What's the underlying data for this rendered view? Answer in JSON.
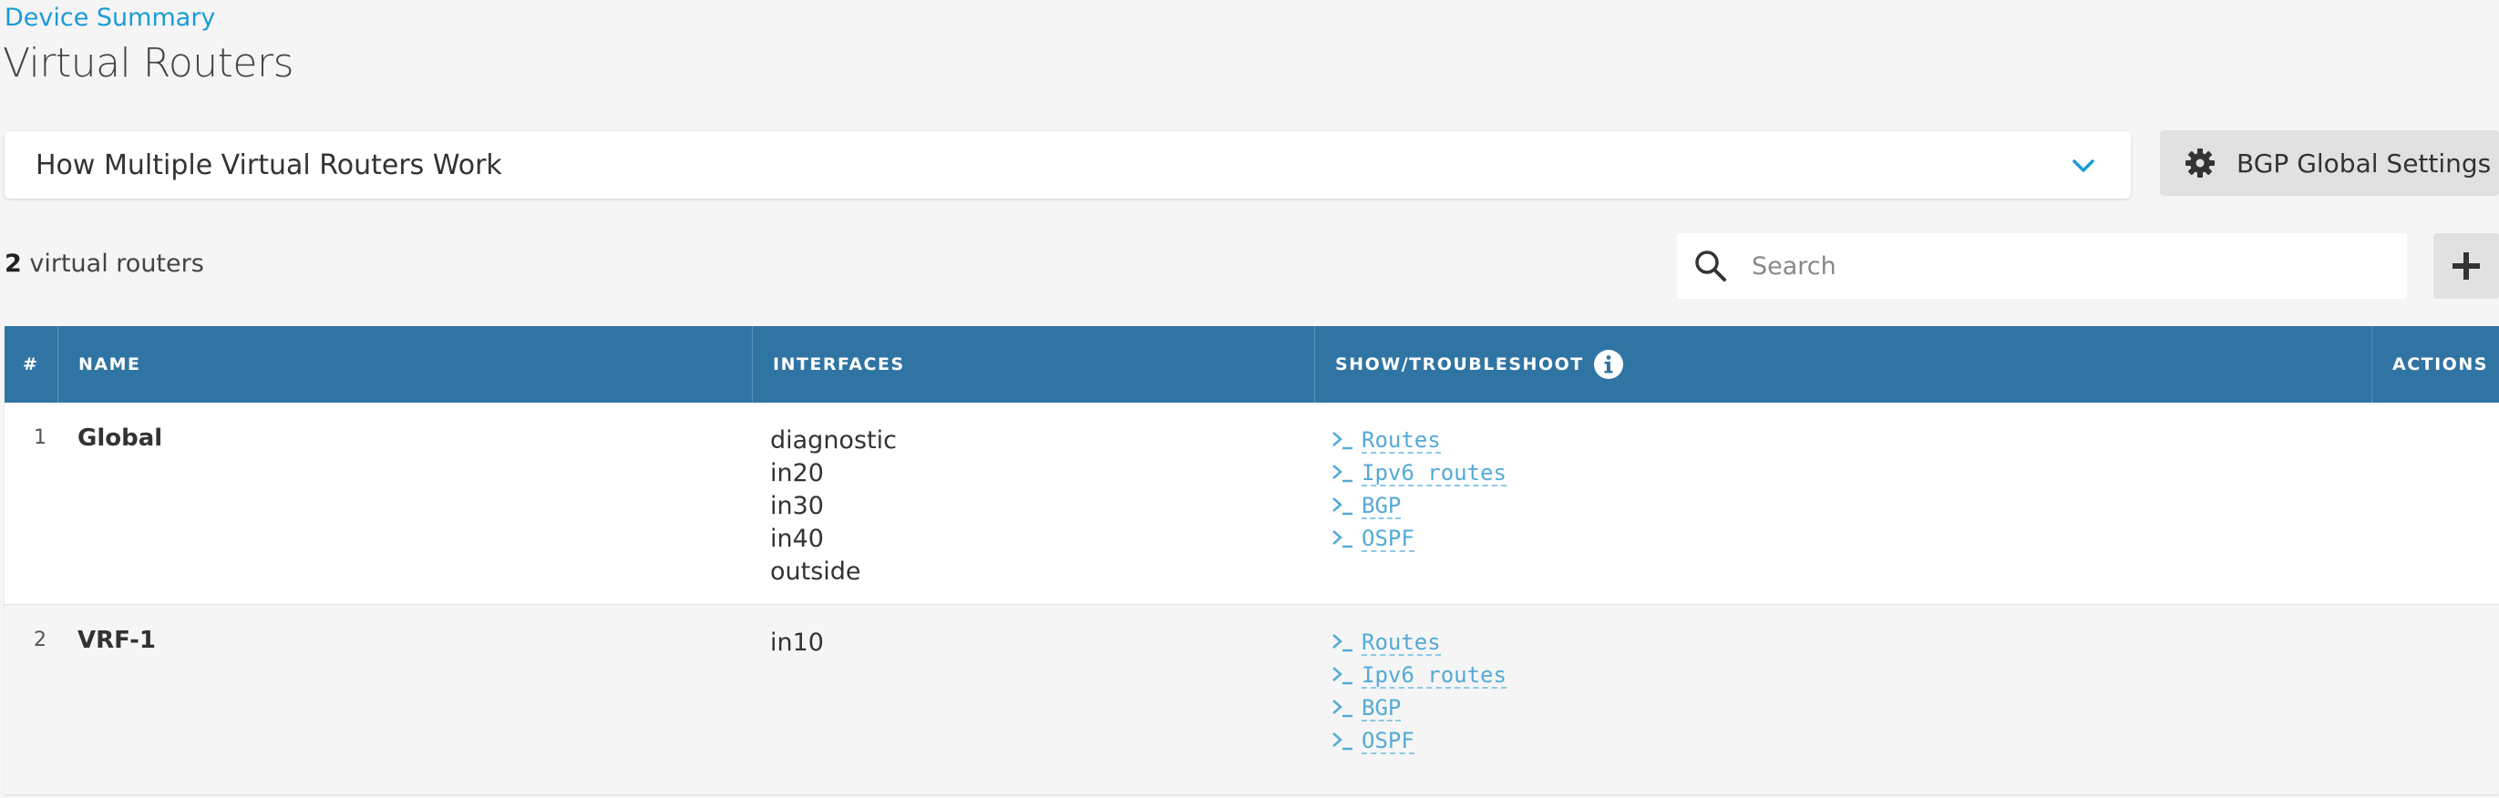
{
  "breadcrumb": "Device Summary",
  "page_title": "Virtual Routers",
  "accordion": {
    "label": "How Multiple Virtual Routers Work"
  },
  "bgp_button": {
    "label": "BGP Global Settings"
  },
  "count": {
    "number": "2",
    "text": " virtual routers"
  },
  "search": {
    "placeholder": "Search",
    "value": ""
  },
  "colors": {
    "header_bg": "#3074a4",
    "link": "#55aad6",
    "breadcrumb": "#1a9bd7"
  },
  "table": {
    "headers": [
      "#",
      "NAME",
      "INTERFACES",
      "SHOW/TROUBLESHOOT",
      "ACTIONS"
    ],
    "rows": [
      {
        "num": "1",
        "name": "Global",
        "interfaces": [
          "diagnostic",
          "in20",
          "in30",
          "in40",
          "outside"
        ],
        "links": [
          "Routes",
          "Ipv6 routes",
          "BGP",
          "OSPF"
        ]
      },
      {
        "num": "2",
        "name": "VRF-1",
        "interfaces": [
          "in10"
        ],
        "links": [
          "Routes",
          "Ipv6 routes",
          "BGP",
          "OSPF"
        ]
      }
    ]
  }
}
